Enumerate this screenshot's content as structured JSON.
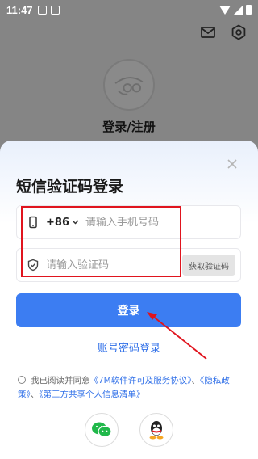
{
  "status_bar": {
    "time": "11:47"
  },
  "page": {
    "heading": "登录/注册"
  },
  "sheet": {
    "title": "短信验证码登录",
    "phone": {
      "country_code": "+86",
      "placeholder": "请输入手机号码"
    },
    "code": {
      "placeholder": "请输入验证码",
      "get_code_label": "获取验证码"
    },
    "login_label": "登录",
    "password_login_label": "账号密码登录"
  },
  "agreement": {
    "prefix": "我已阅读并同意",
    "link1": "《7M软件许可及服务协议》",
    "sep1": "、",
    "link2": "《隐私政策》",
    "sep2": "、",
    "link3": "《第三方共享个人信息清单》"
  },
  "icons": {
    "mail": "mail-icon",
    "settings": "settings-icon",
    "close": "close-icon",
    "phone": "phone-icon",
    "shield": "shield-icon",
    "wechat": "wechat-icon",
    "qq": "qq-icon"
  },
  "colors": {
    "primary": "#3c7df2",
    "link": "#2f6fe8",
    "highlight": "#e0141e",
    "overlay": "#858585"
  }
}
